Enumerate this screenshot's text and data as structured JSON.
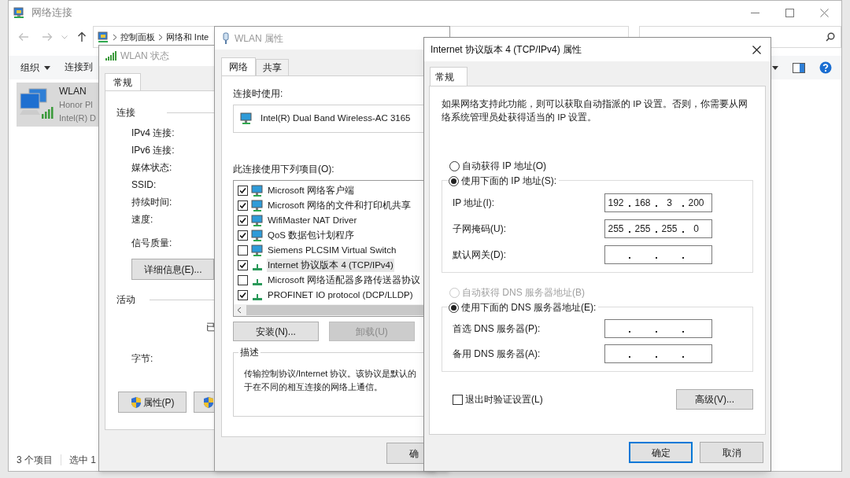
{
  "explorer": {
    "title": "网络连接",
    "breadcrumb": [
      "控制面板",
      "网络和 Inte"
    ],
    "toolbar": [
      "组织",
      "连接到"
    ],
    "item": {
      "name": "WLAN",
      "line_2": "Honor Pl",
      "line_3": "Intel(R) D",
      "selected": true
    },
    "status_bar": [
      "3 个项目",
      "选中 1"
    ]
  },
  "status_dialog": {
    "title": "WLAN 状态",
    "tabs": [
      {
        "label": "常规",
        "selected": true
      }
    ],
    "connection_heading": "连接",
    "fields": [
      "IPv4 连接:",
      "IPv6 连接:",
      "媒体状态:",
      "SSID:",
      "持续时间:",
      "速度:",
      "信号质量:"
    ],
    "details_button": "详细信息(E)...",
    "activity_heading": "活动",
    "activity_text": "已",
    "bytes_label": "字节:",
    "properties_button": "属性(P)"
  },
  "props_dialog": {
    "title": "WLAN 属性",
    "tabs": [
      {
        "label": "网络",
        "selected": true
      },
      {
        "label": "共享",
        "selected": false
      }
    ],
    "connect_using_label": "连接时使用:",
    "adapter": "Intel(R) Dual Band Wireless-AC 3165",
    "items_label": "此连接使用下列项目(O):",
    "items": [
      {
        "label": "Microsoft 网络客户端",
        "checked": true,
        "selected": false,
        "kind": "client"
      },
      {
        "label": "Microsoft 网络的文件和打印机共享",
        "checked": true,
        "selected": false,
        "kind": "client"
      },
      {
        "label": "WifiMaster NAT Driver",
        "checked": true,
        "selected": false,
        "kind": "client"
      },
      {
        "label": "QoS 数据包计划程序",
        "checked": true,
        "selected": false,
        "kind": "client"
      },
      {
        "label": "Siemens PLCSIM Virtual Switch",
        "checked": false,
        "selected": false,
        "kind": "client"
      },
      {
        "label": "Internet 协议版本 4 (TCP/IPv4)",
        "checked": true,
        "selected": true,
        "kind": "protocol"
      },
      {
        "label": "Microsoft 网络适配器多路传送器协议",
        "checked": false,
        "selected": false,
        "kind": "protocol"
      },
      {
        "label": "PROFINET IO protocol (DCP/LLDP)",
        "checked": true,
        "selected": false,
        "kind": "protocol"
      }
    ],
    "buttons": [
      {
        "label": "安装(N)...",
        "disabled": false
      },
      {
        "label": "卸载(U)",
        "disabled": true
      }
    ],
    "description_heading": "描述",
    "description_lines": [
      "传输控制协议/Internet 协议。该协议是默认的",
      "于在不同的相互连接的网络上通信。"
    ],
    "ok_button": "确"
  },
  "ipv4_dialog": {
    "title": "Internet 协议版本 4 (TCP/IPv4) 属性",
    "tabs": [
      {
        "label": "常规",
        "selected": true
      }
    ],
    "intro": "如果网络支持此功能，则可以获取自动指派的 IP 设置。否则，你需要从网络系统管理员处获得适当的 IP 设置。",
    "ip_options": [
      {
        "label": "自动获得 IP 地址(O)",
        "selected": false,
        "disabled": false
      },
      {
        "label": "使用下面的 IP 地址(S):",
        "selected": true,
        "disabled": false
      }
    ],
    "ip_fields": [
      {
        "label": "IP 地址(I):",
        "octets": [
          "192",
          "168",
          "3",
          "200"
        ]
      },
      {
        "label": "子网掩码(U):",
        "octets": [
          "255",
          "255",
          "255",
          "0"
        ]
      },
      {
        "label": "默认网关(D):"
      }
    ],
    "dns_options": [
      {
        "label": "自动获得 DNS 服务器地址(B)",
        "selected": false,
        "disabled": true
      },
      {
        "label": "使用下面的 DNS 服务器地址(E):",
        "selected": true,
        "disabled": false
      }
    ],
    "dns_fields": [
      {
        "label": "首选 DNS 服务器(P):"
      },
      {
        "label": "备用 DNS 服务器(A):"
      }
    ],
    "validate_on_exit": {
      "label": "退出时验证设置(L)",
      "checked": false
    },
    "advanced_button": "高级(V)...",
    "ok_button": "确定",
    "cancel_button": "取消"
  }
}
